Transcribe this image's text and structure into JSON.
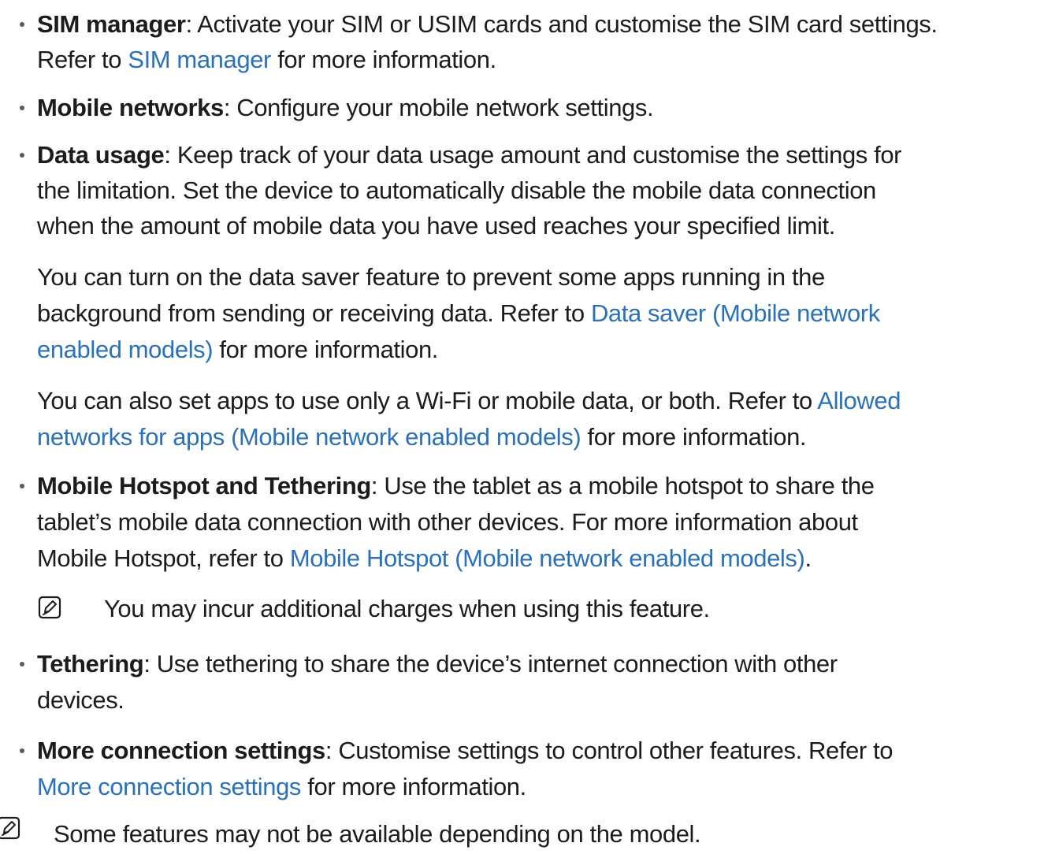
{
  "items": {
    "sim": {
      "term": "SIM manager",
      "desc": ": Activate your SIM or USIM cards and customise the SIM card settings.",
      "line2_pre": "Refer to ",
      "link": "SIM manager",
      "line2_post": " for more information."
    },
    "mobile": {
      "term": "Mobile networks",
      "desc": ": Configure your mobile network settings."
    },
    "data": {
      "term": "Data usage",
      "line1": ": Keep track of your data usage amount and customise the settings for",
      "line2": "the limitation. Set the device to automatically disable the mobile data connection",
      "line3": "when the amount of mobile data you have used reaches your specified limit.",
      "p2_line1": "You can turn on the data saver feature to prevent some apps running in the",
      "p2_line2_pre": "background from sending or receiving data. Refer to ",
      "p2_link_part1": "Data saver (Mobile network",
      "p2_link_part2": "enabled models)",
      "p2_line3_post": " for more information.",
      "p3_line1_pre": "You can also set apps to use only a Wi-Fi or mobile data, or both. Refer to ",
      "p3_link_part1": "Allowed",
      "p3_link_part2": "networks for apps (Mobile network enabled models)",
      "p3_line2_post": " for more information."
    },
    "hotspot": {
      "term": "Mobile Hotspot and Tethering",
      "line1": ": Use the tablet as a mobile hotspot to share the",
      "line2": "tablet’s mobile data connection with other devices. For more information about",
      "line3_pre": "Mobile Hotspot, refer to ",
      "link": "Mobile Hotspot (Mobile network enabled models)",
      "line3_post": ".",
      "note": "You may incur additional charges when using this feature."
    },
    "tethering": {
      "term": "Tethering",
      "line1": ": Use tethering to share the device’s internet connection with other",
      "line2": "devices."
    },
    "more": {
      "term": "More connection settings",
      "line1": ": Customise settings to control other features. Refer to",
      "link": "More connection settings",
      "line2_post": " for more information."
    }
  },
  "footer_note": "Some features may not be available depending on the model."
}
